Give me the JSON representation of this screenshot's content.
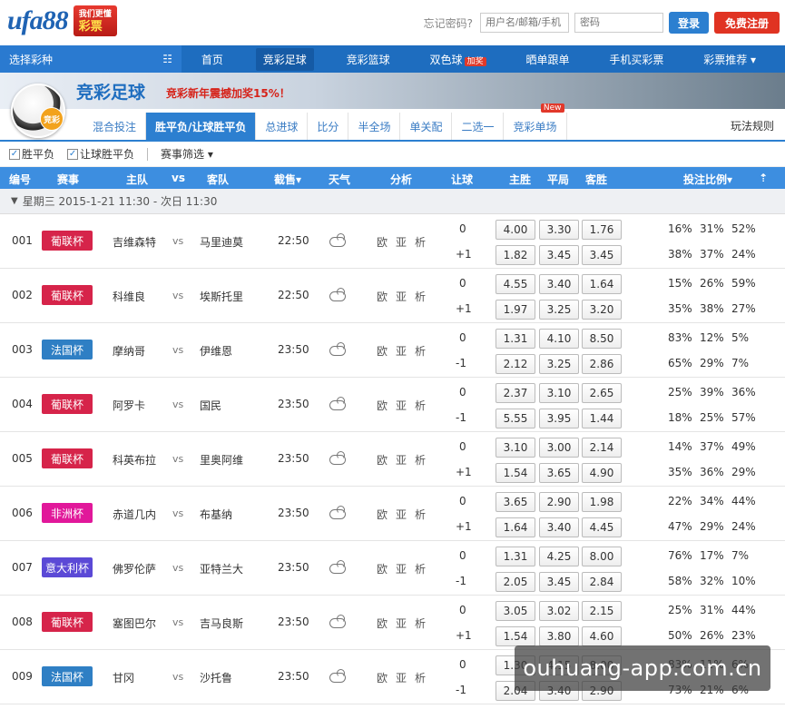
{
  "header": {
    "logo_text": "ufa88",
    "logo_badge_line1": "彩票",
    "logo_badge_line2": "我们更懂",
    "forgot_password": "忘记密码?",
    "username_placeholder": "用户名/邮箱/手机",
    "password_placeholder": "密码",
    "login_button": "登录",
    "register_button": "免费注册"
  },
  "nav": {
    "select_lottery": "选择彩种",
    "items": [
      {
        "label": "首页"
      },
      {
        "label": "竞彩足球"
      },
      {
        "label": "竞彩篮球"
      },
      {
        "label": "双色球",
        "badge": "加奖"
      },
      {
        "label": "晒单跟单"
      },
      {
        "label": "手机买彩票"
      },
      {
        "label": "彩票推荐"
      }
    ]
  },
  "banner": {
    "title": "竞彩足球",
    "promo": "竞彩新年震撼加奖15%！",
    "ball_badge": "竞彩"
  },
  "tabs": {
    "items": [
      "混合投注",
      "胜平负/让球胜平负",
      "总进球",
      "比分",
      "半全场",
      "单关配",
      "二选一",
      "竞彩单场"
    ],
    "active_index": 1,
    "new_badge": "New",
    "rules_link": "玩法规则"
  },
  "filters": {
    "win_draw_lose": "胜平负",
    "handicap": "让球胜平负",
    "match_filter": "赛事筛选"
  },
  "table_header": {
    "id": "编号",
    "league": "赛事",
    "home": "主队",
    "vs": "vs",
    "away": "客队",
    "deadline": "截售",
    "weather": "天气",
    "analysis": "分析",
    "handicap": "让球",
    "home_win": "主胜",
    "draw": "平局",
    "away_win": "客胜",
    "ratio": "投注比例"
  },
  "day_bar": "星期三 2015-1-21 11:30 - 次日 11:30",
  "analysis_labels": [
    "欧",
    "亚",
    "析"
  ],
  "colors": {
    "red_league": "#d6244a",
    "blue_league": "#2f7fc4",
    "pink_league": "#e1189a",
    "purple_league": "#5b49d6"
  },
  "matches": [
    {
      "id": "001",
      "league": "葡联杯",
      "league_color": "#d6244a",
      "home": "吉维森特",
      "away": "马里迪莫",
      "time": "22:50",
      "lines": [
        {
          "handicap": "0",
          "odds": [
            "4.00",
            "3.30",
            "1.76"
          ],
          "ratio": [
            "16%",
            "31%",
            "52%"
          ]
        },
        {
          "handicap": "+1",
          "odds": [
            "1.82",
            "3.45",
            "3.45"
          ],
          "ratio": [
            "38%",
            "37%",
            "24%"
          ]
        }
      ]
    },
    {
      "id": "002",
      "league": "葡联杯",
      "league_color": "#d6244a",
      "home": "科维良",
      "away": "埃斯托里",
      "time": "22:50",
      "lines": [
        {
          "handicap": "0",
          "odds": [
            "4.55",
            "3.40",
            "1.64"
          ],
          "ratio": [
            "15%",
            "26%",
            "59%"
          ]
        },
        {
          "handicap": "+1",
          "odds": [
            "1.97",
            "3.25",
            "3.20"
          ],
          "ratio": [
            "35%",
            "38%",
            "27%"
          ]
        }
      ]
    },
    {
      "id": "003",
      "league": "法国杯",
      "league_color": "#2f7fc4",
      "home": "摩纳哥",
      "away": "伊维恩",
      "time": "23:50",
      "lines": [
        {
          "handicap": "0",
          "odds": [
            "1.31",
            "4.10",
            "8.50"
          ],
          "ratio": [
            "83%",
            "12%",
            "5%"
          ]
        },
        {
          "handicap": "-1",
          "odds": [
            "2.12",
            "3.25",
            "2.86"
          ],
          "ratio": [
            "65%",
            "29%",
            "7%"
          ]
        }
      ]
    },
    {
      "id": "004",
      "league": "葡联杯",
      "league_color": "#d6244a",
      "home": "阿罗卡",
      "away": "国民",
      "time": "23:50",
      "lines": [
        {
          "handicap": "0",
          "odds": [
            "2.37",
            "3.10",
            "2.65"
          ],
          "ratio": [
            "25%",
            "39%",
            "36%"
          ]
        },
        {
          "handicap": "-1",
          "odds": [
            "5.55",
            "3.95",
            "1.44"
          ],
          "ratio": [
            "18%",
            "25%",
            "57%"
          ]
        }
      ]
    },
    {
      "id": "005",
      "league": "葡联杯",
      "league_color": "#d6244a",
      "home": "科英布拉",
      "away": "里奥阿维",
      "time": "23:50",
      "lines": [
        {
          "handicap": "0",
          "odds": [
            "3.10",
            "3.00",
            "2.14"
          ],
          "ratio": [
            "14%",
            "37%",
            "49%"
          ]
        },
        {
          "handicap": "+1",
          "odds": [
            "1.54",
            "3.65",
            "4.90"
          ],
          "ratio": [
            "35%",
            "36%",
            "29%"
          ]
        }
      ]
    },
    {
      "id": "006",
      "league": "非洲杯",
      "league_color": "#e1189a",
      "home": "赤道几内",
      "away": "布基纳",
      "time": "23:50",
      "lines": [
        {
          "handicap": "0",
          "odds": [
            "3.65",
            "2.90",
            "1.98"
          ],
          "ratio": [
            "22%",
            "34%",
            "44%"
          ]
        },
        {
          "handicap": "+1",
          "odds": [
            "1.64",
            "3.40",
            "4.45"
          ],
          "ratio": [
            "47%",
            "29%",
            "24%"
          ]
        }
      ]
    },
    {
      "id": "007",
      "league": "意大利杯",
      "league_color": "#5b49d6",
      "home": "佛罗伦萨",
      "away": "亚特兰大",
      "time": "23:50",
      "lines": [
        {
          "handicap": "0",
          "odds": [
            "1.31",
            "4.25",
            "8.00"
          ],
          "ratio": [
            "76%",
            "17%",
            "7%"
          ]
        },
        {
          "handicap": "-1",
          "odds": [
            "2.05",
            "3.45",
            "2.84"
          ],
          "ratio": [
            "58%",
            "32%",
            "10%"
          ]
        }
      ]
    },
    {
      "id": "008",
      "league": "葡联杯",
      "league_color": "#d6244a",
      "home": "塞图巴尔",
      "away": "吉马良斯",
      "time": "23:50",
      "lines": [
        {
          "handicap": "0",
          "odds": [
            "3.05",
            "3.02",
            "2.15"
          ],
          "ratio": [
            "25%",
            "31%",
            "44%"
          ]
        },
        {
          "handicap": "+1",
          "odds": [
            "1.54",
            "3.80",
            "4.60"
          ],
          "ratio": [
            "50%",
            "26%",
            "23%"
          ]
        }
      ]
    },
    {
      "id": "009",
      "league": "法国杯",
      "league_color": "#2f7fc4",
      "home": "甘冈",
      "away": "沙托鲁",
      "time": "23:50",
      "lines": [
        {
          "handicap": "0",
          "odds": [
            "1.30",
            "4.15",
            "8.00"
          ],
          "ratio": [
            "83%",
            "11%",
            "6%"
          ]
        },
        {
          "handicap": "-1",
          "odds": [
            "2.04",
            "3.40",
            "2.90"
          ],
          "ratio": [
            "73%",
            "21%",
            "6%"
          ]
        }
      ]
    }
  ],
  "watermark": "ouhuang-app.com.cn"
}
